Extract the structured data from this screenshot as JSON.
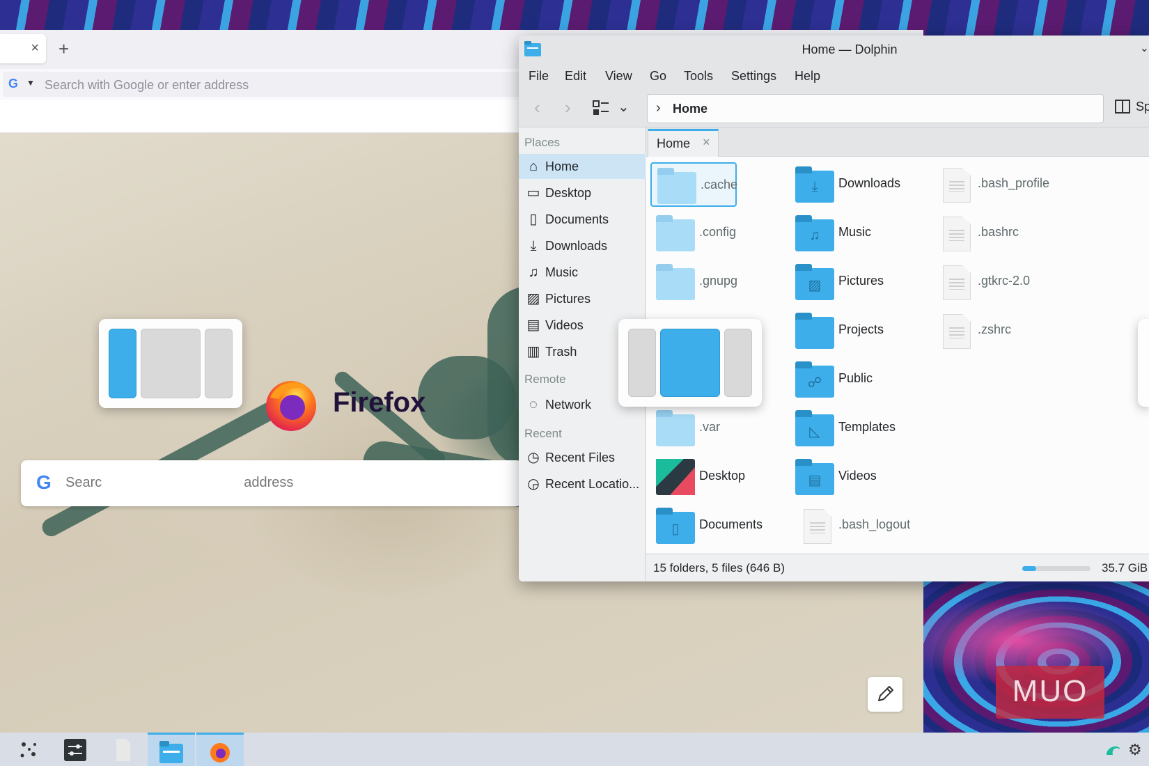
{
  "firefox": {
    "url_placeholder": "Search with Google or enter address",
    "tab_close": "×",
    "new_tab": "+",
    "search_engine_glyph": "G",
    "brand": "Firefox",
    "search_placeholder_left": "Searc",
    "search_placeholder_right": "address"
  },
  "dolphin": {
    "title": "Home — Dolphin",
    "menus": [
      "File",
      "Edit",
      "View",
      "Go",
      "Tools",
      "Settings",
      "Help"
    ],
    "location": "Home",
    "split_label": "Sp",
    "tab_label": "Home",
    "places_sections": [
      "Places",
      "Remote",
      "Recent"
    ],
    "places": [
      {
        "label": "Home",
        "icon": "home-icon",
        "active": true
      },
      {
        "label": "Desktop",
        "icon": "desktop-icon"
      },
      {
        "label": "Documents",
        "icon": "documents-icon"
      },
      {
        "label": "Downloads",
        "icon": "downloads-icon"
      },
      {
        "label": "Music",
        "icon": "music-icon"
      },
      {
        "label": "Pictures",
        "icon": "pictures-icon"
      },
      {
        "label": "Videos",
        "icon": "videos-icon"
      },
      {
        "label": "Trash",
        "icon": "trash-icon"
      }
    ],
    "remote": [
      {
        "label": "Network",
        "icon": "network-icon"
      }
    ],
    "recent": [
      {
        "label": "Recent Files",
        "icon": "recent-files-icon"
      },
      {
        "label": "Recent Locatio...",
        "icon": "recent-locations-icon"
      }
    ],
    "entries": [
      {
        "name": ".cache",
        "kind": "hidden-folder"
      },
      {
        "name": ".config",
        "kind": "hidden-folder"
      },
      {
        "name": ".gnupg",
        "kind": "hidden-folder"
      },
      {
        "name": ".var",
        "kind": "hidden-folder"
      },
      {
        "name": "Desktop",
        "kind": "desktop-folder"
      },
      {
        "name": "Documents",
        "kind": "folder"
      },
      {
        "name": "Downloads",
        "kind": "folder"
      },
      {
        "name": "Music",
        "kind": "folder"
      },
      {
        "name": "Pictures",
        "kind": "folder"
      },
      {
        "name": "Projects",
        "kind": "folder"
      },
      {
        "name": "Public",
        "kind": "folder"
      },
      {
        "name": "Templates",
        "kind": "folder"
      },
      {
        "name": "Videos",
        "kind": "folder"
      },
      {
        "name": ".bash_logout",
        "kind": "file"
      },
      {
        "name": ".bash_profile",
        "kind": "file"
      },
      {
        "name": ".bashrc",
        "kind": "file"
      },
      {
        "name": ".gtkrc-2.0",
        "kind": "file"
      },
      {
        "name": ".zshrc",
        "kind": "file"
      }
    ],
    "status_text": "15 folders, 5 files (646 B)",
    "free_space": "35.7 GiB",
    "space_used_fraction": 0.2
  },
  "watermark": "MUO",
  "colors": {
    "accent": "#3daee9",
    "selection_bg": "#cde4f5",
    "firefox_brand_text": "#20123a"
  }
}
